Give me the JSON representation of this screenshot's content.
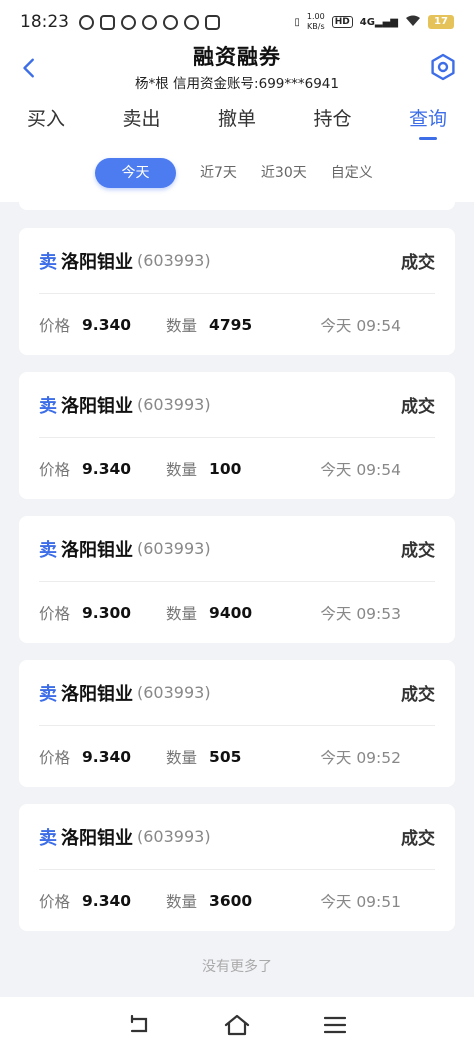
{
  "status_bar": {
    "time": "18:23",
    "speed_value": "1.00",
    "speed_unit": "KB/s",
    "hd": "HD",
    "network": "4G",
    "battery": "17"
  },
  "header": {
    "title": "融资融券",
    "subtitle": "杨*根  信用资金账号:699***6941"
  },
  "tabs": [
    {
      "label": "买入"
    },
    {
      "label": "卖出"
    },
    {
      "label": "撤单"
    },
    {
      "label": "持仓"
    },
    {
      "label": "查询"
    }
  ],
  "filters": [
    {
      "label": "今天"
    },
    {
      "label": "近7天"
    },
    {
      "label": "近30天"
    },
    {
      "label": "自定义"
    }
  ],
  "labels": {
    "price": "价格",
    "quantity": "数量"
  },
  "records": [
    {
      "side": "卖",
      "name": "洛阳钼业",
      "code": "(603993)",
      "status": "成交",
      "price": "9.340",
      "quantity": "4795",
      "time": "今天 09:54"
    },
    {
      "side": "卖",
      "name": "洛阳钼业",
      "code": "(603993)",
      "status": "成交",
      "price": "9.340",
      "quantity": "100",
      "time": "今天 09:54"
    },
    {
      "side": "卖",
      "name": "洛阳钼业",
      "code": "(603993)",
      "status": "成交",
      "price": "9.300",
      "quantity": "9400",
      "time": "今天 09:53"
    },
    {
      "side": "卖",
      "name": "洛阳钼业",
      "code": "(603993)",
      "status": "成交",
      "price": "9.340",
      "quantity": "505",
      "time": "今天 09:52"
    },
    {
      "side": "卖",
      "name": "洛阳钼业",
      "code": "(603993)",
      "status": "成交",
      "price": "9.340",
      "quantity": "3600",
      "time": "今天 09:51"
    }
  ],
  "no_more": "没有更多了",
  "colors": {
    "accent": "#3d6ee8",
    "chip_active": "#4d7bf0",
    "background": "#f2f3f7"
  }
}
